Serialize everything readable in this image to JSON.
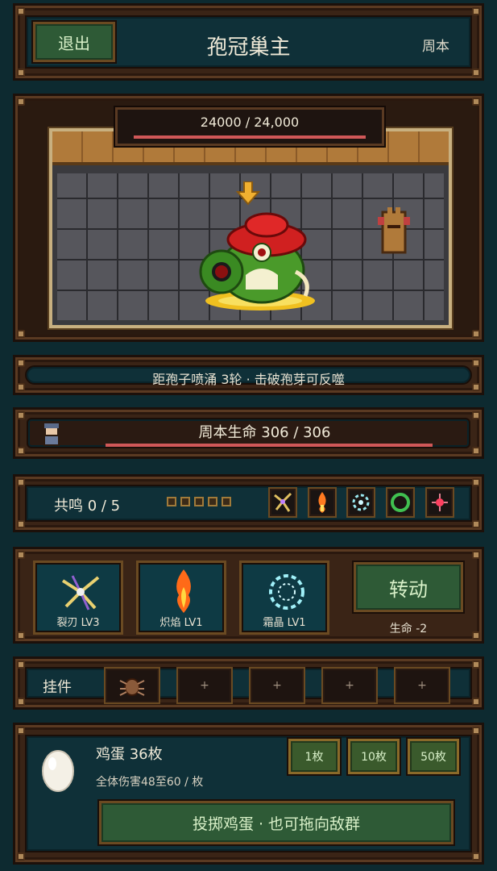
{
  "header": {
    "exit_label": "退出",
    "title": "孢冠巢主",
    "mode": "周本"
  },
  "boss": {
    "hp_text": "24000 / 24,000",
    "hp_fraction": 1.0
  },
  "info": {
    "text": "距孢子喷涌 3轮 · 击破孢芽可反噬"
  },
  "player": {
    "hp_text": "周本生命 306 / 306",
    "hp_fraction": 1.0
  },
  "resonance": {
    "text": "共鸣 0 / 5",
    "filled": 0,
    "total": 5,
    "icons": [
      "rift-icon",
      "flame-icon",
      "frost-icon",
      "ring-icon",
      "spark-icon"
    ]
  },
  "skills": {
    "items": [
      {
        "name": "裂刃 LV3",
        "icon": "rift-blade-icon"
      },
      {
        "name": "炽焰 LV1",
        "icon": "blaze-icon"
      },
      {
        "name": "霜晶 LV1",
        "icon": "frost-crystal-icon"
      }
    ],
    "spin_label": "转动",
    "spin_cost": "生命 -2"
  },
  "plugins": {
    "label": "挂件",
    "empty_glyph": "+"
  },
  "egg": {
    "name": "鸡蛋 36枚",
    "desc": "全体伤害48至60 / 枚",
    "qty_options": [
      "1枚",
      "10枚",
      "50枚"
    ],
    "throw_label": "投掷鸡蛋 · 也可拖向敌群"
  },
  "colors": {
    "hp_bar": "#d05858",
    "panel_teal": "#0f3038",
    "wood": "#3a2416",
    "button_green": "#2e5a36"
  }
}
